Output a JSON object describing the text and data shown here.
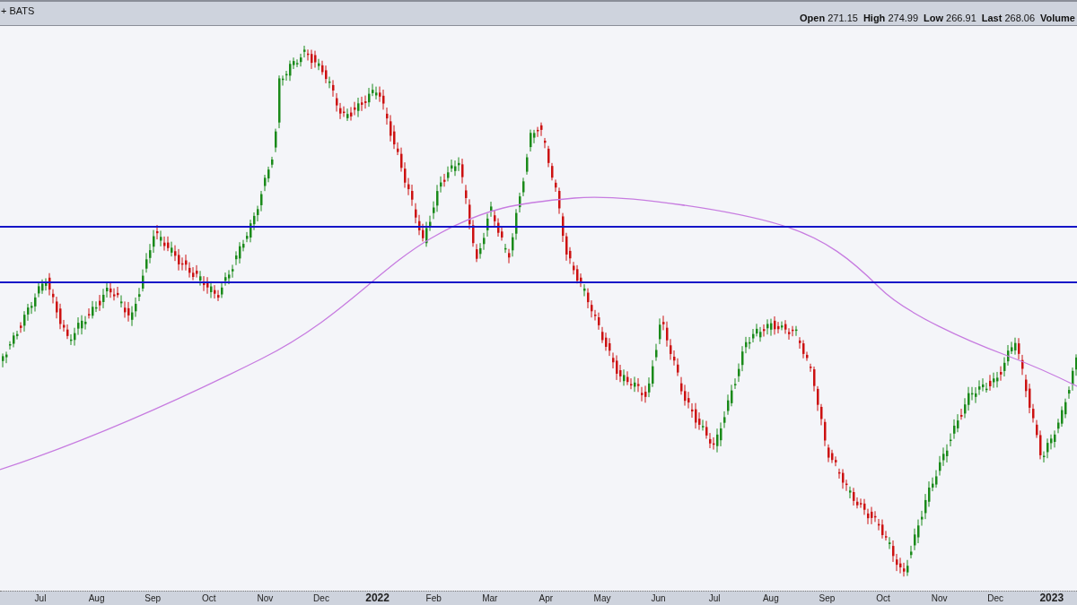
{
  "header": {
    "symbol": "+ BATS",
    "quote": [
      {
        "label": "Open",
        "value": "271.15"
      },
      {
        "label": "High",
        "value": "274.99"
      },
      {
        "label": "Low",
        "value": "266.91"
      },
      {
        "label": "Last",
        "value": "268.06"
      },
      {
        "label": "Volume"
      }
    ]
  },
  "x_axis": {
    "labels": [
      {
        "text": "Jul",
        "kind": "month"
      },
      {
        "text": "Aug",
        "kind": "month"
      },
      {
        "text": "Sep",
        "kind": "month"
      },
      {
        "text": "Oct",
        "kind": "month"
      },
      {
        "text": "Nov",
        "kind": "month"
      },
      {
        "text": "Dec",
        "kind": "month"
      },
      {
        "text": "2022",
        "kind": "year"
      },
      {
        "text": "Feb",
        "kind": "month"
      },
      {
        "text": "Mar",
        "kind": "month"
      },
      {
        "text": "Apr",
        "kind": "month"
      },
      {
        "text": "May",
        "kind": "month"
      },
      {
        "text": "Jun",
        "kind": "month"
      },
      {
        "text": "Jul",
        "kind": "month"
      },
      {
        "text": "Aug",
        "kind": "month"
      },
      {
        "text": "Sep",
        "kind": "month"
      },
      {
        "text": "Oct",
        "kind": "month"
      },
      {
        "text": "Nov",
        "kind": "month"
      },
      {
        "text": "Dec",
        "kind": "month"
      },
      {
        "text": "2023",
        "kind": "year"
      }
    ]
  }
}
